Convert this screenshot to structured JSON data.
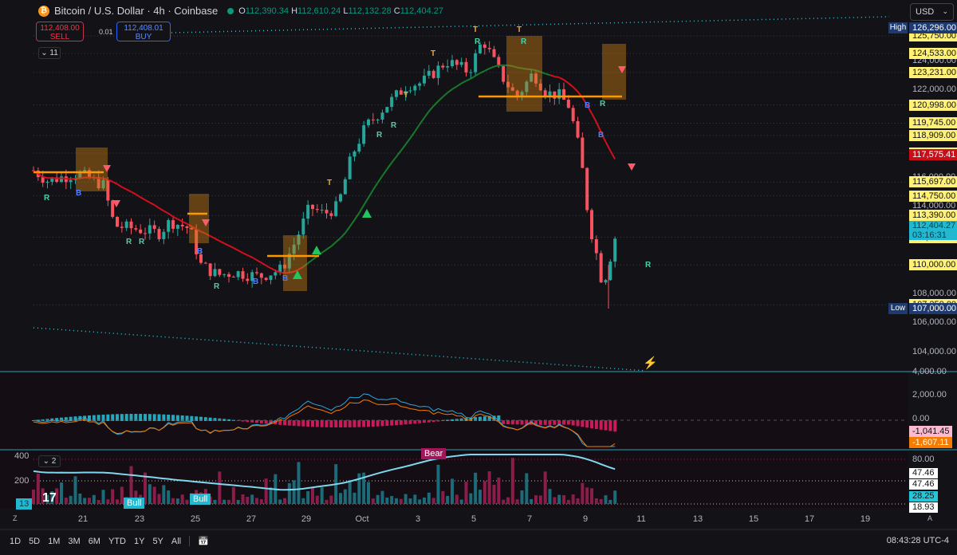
{
  "header": {
    "symbol": "Bitcoin / U.S. Dollar · 4h · Coinbase",
    "o_label": "O",
    "o": "112,390.34",
    "h_label": "H",
    "h": "112,610.24",
    "l_label": "L",
    "l": "112,132.28",
    "c_label": "C",
    "c": "112,404.27"
  },
  "trade": {
    "sell_price": "112,408.00",
    "sell_label": "SELL",
    "spread": "0.01",
    "buy_price": "112,408.01",
    "buy_label": "BUY"
  },
  "indicators_collapsed": "11",
  "volume_collapsed": "2",
  "currency": "USD",
  "price_axis": {
    "ticks": [
      "124,000.00",
      "122,000.00",
      "116,000.00",
      "114,000.00",
      "108,000.00",
      "106,000.00",
      "104,000.00"
    ],
    "tick_values": [
      124000,
      122000,
      116000,
      114000,
      108000,
      106000,
      104000
    ],
    "high_tag": "High",
    "high": "126,296.00",
    "low_tag": "Low",
    "low": "107,000.00",
    "levels": [
      {
        "v": 125750,
        "t": "125,750.00"
      },
      {
        "v": 124533,
        "t": "124,533.00"
      },
      {
        "v": 123231,
        "t": "123,231.00"
      },
      {
        "v": 120998,
        "t": "120,998.00"
      },
      {
        "v": 119745,
        "t": "119,745.00"
      },
      {
        "v": 118909,
        "t": "118,909.00"
      },
      {
        "v": 117687,
        "t": "117,687.00"
      },
      {
        "v": 115697,
        "t": "115,697.00"
      },
      {
        "v": 114750,
        "t": "114,750.00"
      },
      {
        "v": 113390,
        "t": "113,390.00"
      },
      {
        "v": 111903,
        "t": "111,903.00"
      },
      {
        "v": 110000,
        "t": "110,000.00"
      },
      {
        "v": 107250,
        "t": "107,250.00"
      }
    ],
    "ma_label": "117,575.41",
    "last": "112,404.27",
    "countdown": "03:16:31"
  },
  "macd_axis": {
    "ticks": [
      "4,000.00",
      "2,000.00",
      "0.00"
    ],
    "hist_label": "-1,041.45",
    "signal_label": "-1,607.11"
  },
  "vol_axis": {
    "left_ticks": [
      "400",
      "200"
    ],
    "right_ticks": [
      "80.00"
    ],
    "labels": [
      "47.46",
      "47.46",
      "28.25",
      "18.93"
    ],
    "left_tag": "13",
    "bull": "Bull",
    "bear": "Bear"
  },
  "time_axis": [
    "21",
    "23",
    "25",
    "27",
    "29",
    "Oct",
    "3",
    "5",
    "7",
    "9",
    "11",
    "13",
    "15",
    "17",
    "19"
  ],
  "toolbar": {
    "ranges": [
      "1D",
      "5D",
      "1M",
      "3M",
      "6M",
      "YTD",
      "1Y",
      "5Y",
      "All"
    ],
    "clock": "08:43:28 UTC-4"
  },
  "colors": {
    "up": "#26a69a",
    "down": "#f7525f",
    "ma_down": "#d2101e",
    "ma_up": "#167a2a",
    "level": "#fff176",
    "macd": "#2fa8d8",
    "signal": "#f57c00"
  },
  "chart_data": {
    "type": "candlestick",
    "title": "Bitcoin / U.S. Dollar · 4h · Coinbase",
    "x_unit": "days since Sep 19",
    "x": [
      0,
      0.5,
      1.6,
      2.5,
      2.9,
      3.6,
      4.5,
      4.9,
      5.6,
      6,
      6.6,
      7.2,
      8.1,
      8.9,
      9.4,
      9.9,
      10.4,
      10.9,
      11.4,
      11.9,
      12.5,
      13.4,
      13.9,
      14.8,
      15.6,
      16.1,
      16.7,
      17.3,
      17.9,
      18.4,
      18.8,
      19.2,
      19.6,
      19.9,
      20.2,
      20.4,
      20.9
    ],
    "close": [
      116500,
      115800,
      116300,
      115500,
      112700,
      112500,
      112200,
      113000,
      112500,
      110000,
      109300,
      109500,
      109200,
      109700,
      111700,
      114000,
      113500,
      114000,
      117500,
      119500,
      120700,
      122400,
      122500,
      124000,
      123300,
      125500,
      123200,
      121500,
      123200,
      121800,
      121700,
      120900,
      117500,
      113000,
      110500,
      108500,
      112404
    ],
    "high": 126296,
    "low": 107000,
    "ylim": [
      103000,
      127500
    ]
  }
}
